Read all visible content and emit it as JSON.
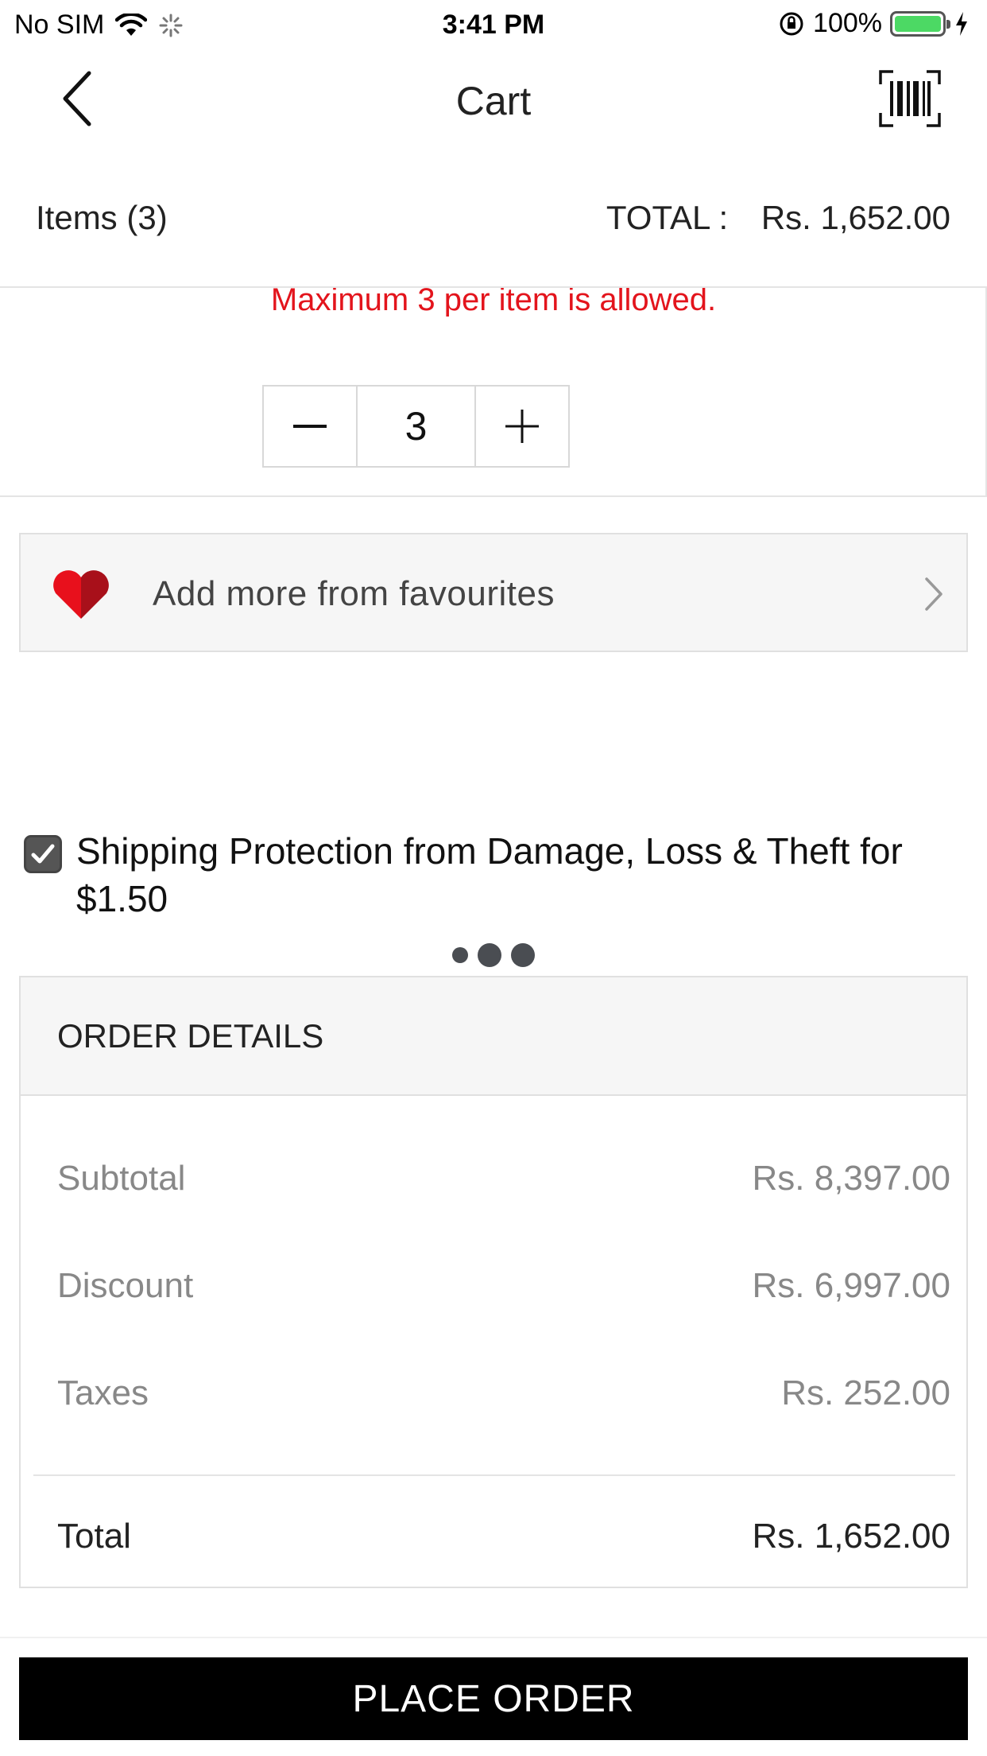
{
  "status_bar": {
    "carrier": "No SIM",
    "time": "3:41 PM",
    "battery": "100%"
  },
  "nav": {
    "title": "Cart",
    "back_icon": "chevron-left-icon",
    "scan_icon": "barcode-icon"
  },
  "summary": {
    "items_label": "Items",
    "items_count": "(3)",
    "total_label": "TOTAL :",
    "total_value": "Rs. 1,652.00"
  },
  "cart_item": {
    "max_message": "Maximum 3 per item is allowed.",
    "quantity": "3"
  },
  "favourites": {
    "label": "Add more from favourites"
  },
  "shipping_protection": {
    "checked": true,
    "text": "Shipping Protection from Damage, Loss & Theft for $1.50"
  },
  "order_details": {
    "title": "ORDER DETAILS",
    "rows": [
      {
        "label": "Subtotal",
        "value": "Rs. 8,397.00"
      },
      {
        "label": "Discount",
        "value": "Rs. 6,997.00"
      },
      {
        "label": "Taxes",
        "value": "Rs. 252.00"
      }
    ],
    "total_label": "Total",
    "total_value": "Rs. 1,652.00"
  },
  "place_order": {
    "label": "PLACE ORDER"
  },
  "colors": {
    "error": "#e3141c",
    "heart": "#d8131f",
    "battery": "#4cd964",
    "primary_button": "#000000"
  }
}
